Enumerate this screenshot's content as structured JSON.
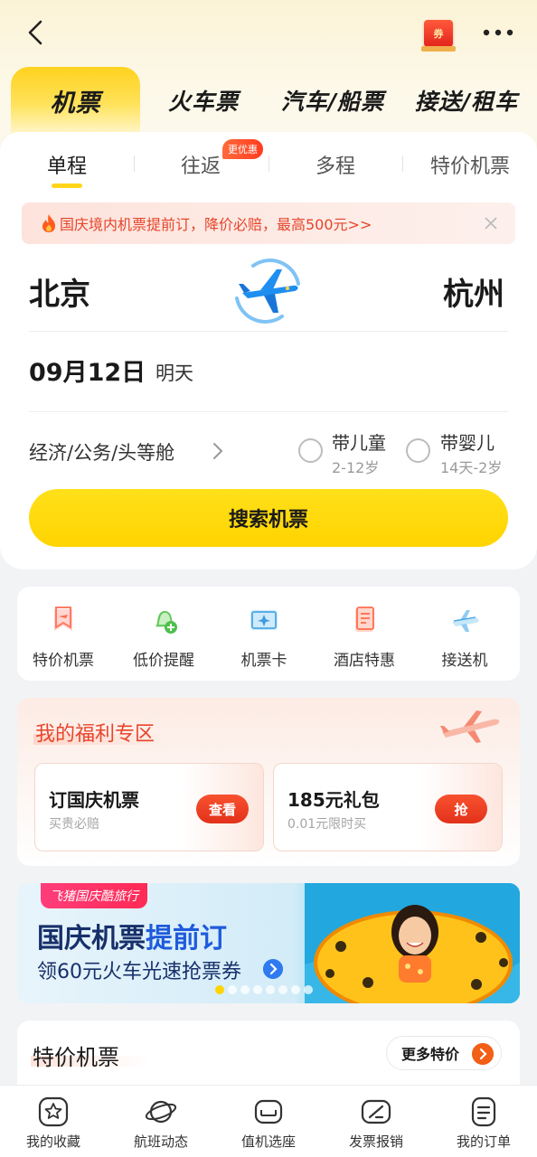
{
  "header": {
    "coupon_label": "券",
    "icons": {
      "back": "back-arrow-icon",
      "more": "more-dots-icon"
    }
  },
  "main_tabs": [
    {
      "label": "机票",
      "active": true
    },
    {
      "label": "火车票"
    },
    {
      "label": "汽车/船票"
    },
    {
      "label": "接送/租车"
    }
  ],
  "trip_tabs": [
    {
      "label": "单程",
      "active": true
    },
    {
      "label": "往返",
      "badge": "更优惠"
    },
    {
      "label": "多程"
    },
    {
      "label": "特价机票"
    }
  ],
  "notice": {
    "text": "国庆境内机票提前订，降价必赔，最高500元>>"
  },
  "route": {
    "from": "北京",
    "to": "杭州"
  },
  "date": {
    "value": "09月12日",
    "relative": "明天"
  },
  "cabin": {
    "label": "经济/公务/头等舱"
  },
  "passengers": {
    "child": {
      "label": "带儿童",
      "sub": "2-12岁"
    },
    "infant": {
      "label": "带婴儿",
      "sub": "14天-2岁"
    }
  },
  "search_button": "搜索机票",
  "quick_links": [
    {
      "label": "特价机票",
      "icon": "ticket-flag-icon"
    },
    {
      "label": "低价提醒",
      "icon": "bell-plus-icon"
    },
    {
      "label": "机票卡",
      "icon": "plane-card-icon"
    },
    {
      "label": "酒店特惠",
      "icon": "hotel-document-icon"
    },
    {
      "label": "接送机",
      "icon": "shuttle-plane-icon"
    }
  ],
  "welfare": {
    "title": "我的福利专区",
    "deals": [
      {
        "title": "订国庆机票",
        "sub": "买贵必赔",
        "button": "查看"
      },
      {
        "title": "185元礼包",
        "sub": "0.01元限时买",
        "button": "抢"
      }
    ]
  },
  "banner": {
    "tag": "飞猪国庆酷旅行",
    "title_main": "国庆机票",
    "title_highlight": "提前订",
    "subtitle": "领60元火车光速抢票券",
    "slides": 8,
    "active_slide": 0
  },
  "special_deals": {
    "title": "特价机票",
    "more_label": "更多特价"
  },
  "bottom_nav": [
    {
      "label": "我的收藏",
      "icon": "star-icon"
    },
    {
      "label": "航班动态",
      "icon": "planet-icon"
    },
    {
      "label": "值机选座",
      "icon": "seat-icon"
    },
    {
      "label": "发票报销",
      "icon": "invoice-icon"
    },
    {
      "label": "我的订单",
      "icon": "order-icon"
    }
  ],
  "colors": {
    "accent_yellow": "#FFD400",
    "promo_red": "#E5452A",
    "link_orange": "#F25F16"
  }
}
